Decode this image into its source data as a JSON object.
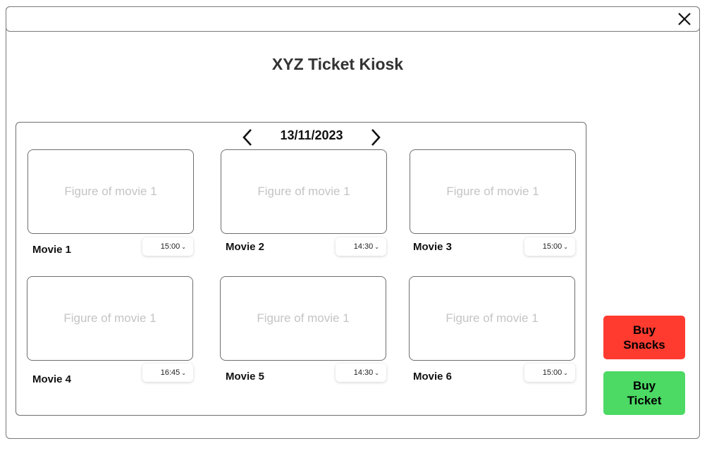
{
  "app": {
    "title": "XYZ Ticket Kiosk"
  },
  "date_nav": {
    "date": "13/11/2023"
  },
  "movies": [
    {
      "title": "Movie 1",
      "figure": "Figure of movie 1",
      "time": "15:00"
    },
    {
      "title": "Movie 2",
      "figure": "Figure of movie 1",
      "time": "14:30"
    },
    {
      "title": "Movie 3",
      "figure": "Figure of movie 1",
      "time": "15:00"
    },
    {
      "title": "Movie 4",
      "figure": "Figure of movie 1",
      "time": "16:45"
    },
    {
      "title": "Movie 5",
      "figure": "Figure of movie 1",
      "time": "14:30"
    },
    {
      "title": "Movie 6",
      "figure": "Figure of movie 1",
      "time": "15:00"
    }
  ],
  "actions": {
    "buy_snacks": "Buy Snacks",
    "buy_ticket": "Buy Ticket"
  },
  "colors": {
    "buy_snacks_bg": "#ff3b30",
    "buy_ticket_bg": "#4cd964"
  },
  "icons": {
    "close": "close-icon",
    "prev": "chevron-left-icon",
    "next": "chevron-right-icon",
    "dropdown": "chevron-down-icon"
  }
}
